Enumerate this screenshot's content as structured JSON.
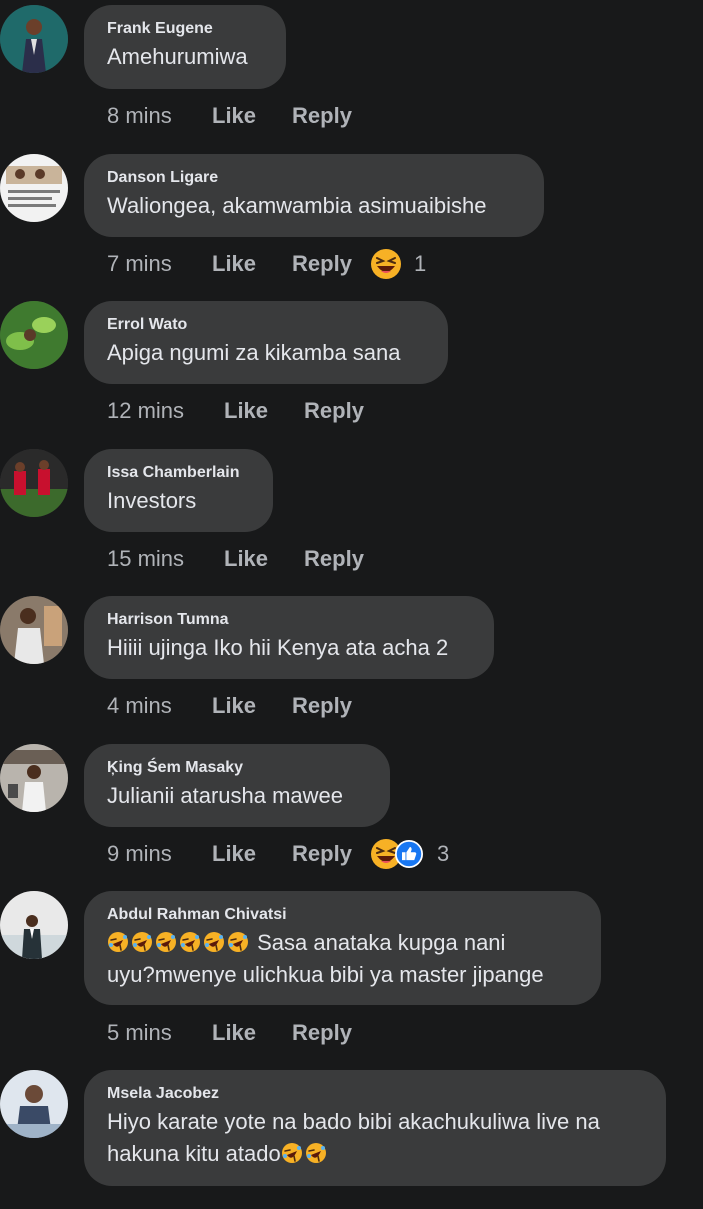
{
  "comments": [
    {
      "author": "Frank Eugene",
      "text": "Amehurumiwa",
      "time": "8 mins",
      "like": "Like",
      "reply": "Reply"
    },
    {
      "author": "Danson Ligare",
      "text": "Waliongea, akamwambia asimuaibishe",
      "time": "7 mins",
      "like": "Like",
      "reply": "Reply",
      "reaction_count": "1"
    },
    {
      "author": "Errol Wato",
      "text": "Apiga ngumi za kikamba sana",
      "time": "12 mins",
      "like": "Like",
      "reply": "Reply"
    },
    {
      "author": "Issa Chamberlain",
      "text": "Investors",
      "time": "15 mins",
      "like": "Like",
      "reply": "Reply"
    },
    {
      "author": "Harrison Tumna",
      "text": "Hiiii ujinga Iko hii Kenya ata acha 2",
      "time": "4 mins",
      "like": "Like",
      "reply": "Reply"
    },
    {
      "author": "Ķing Śem Masaky",
      "text": "Julianii atarusha mawee",
      "time": "9 mins",
      "like": "Like",
      "reply": "Reply",
      "reaction_count": "3"
    },
    {
      "author": "Abdul Rahman Chivatsi",
      "text_line1": "Sasa anataka kupga nani",
      "text_line2": "uyu?mwenye ulichkua bibi ya master jipange",
      "time": "5 mins",
      "like": "Like",
      "reply": "Reply"
    },
    {
      "author": "Msela Jacobez",
      "text_line1": "Hiyo karate yote na bado bibi akachukuliwa live na",
      "text_line2": "hakuna kitu atado",
      "time": "",
      "like": "",
      "reply": ""
    }
  ],
  "colors": {
    "background": "#18191a",
    "bubble": "#3a3b3c",
    "meta": "#b0b3b8",
    "like_blue": "#1877f2",
    "haha_yellow": "#f7b125"
  },
  "icons": [
    "haha-reaction-icon",
    "like-reaction-icon",
    "rofl-emoji-icon"
  ]
}
